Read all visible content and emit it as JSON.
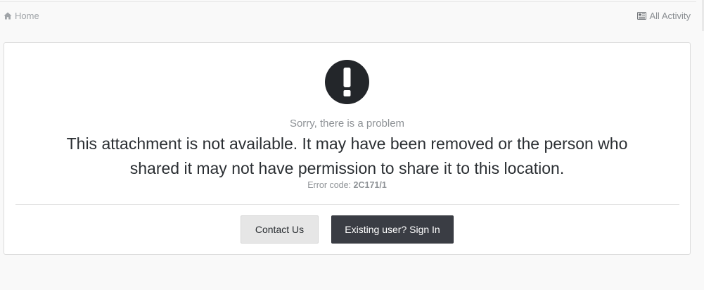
{
  "breadcrumb": {
    "home_label": "Home",
    "activity_label": "All Activity"
  },
  "error": {
    "subtitle": "Sorry, there is a problem",
    "message": "This attachment is not available. It may have been removed or the person who shared it may not have permission to share it to this location.",
    "code_label": "Error code:",
    "code_value": "2C171/1"
  },
  "actions": {
    "contact_label": "Contact Us",
    "signin_label": "Existing user? Sign In"
  },
  "icons": {
    "home": "home-icon",
    "activity": "newspaper-icon",
    "alert": "exclamation-circle-icon"
  },
  "colors": {
    "page_bg": "#f9f9f9",
    "card_bg": "#ffffff",
    "text_dark": "#2b2f33",
    "text_muted": "#8e9296",
    "button_dark": "#3a3d44",
    "button_light": "#e6e6e6"
  }
}
